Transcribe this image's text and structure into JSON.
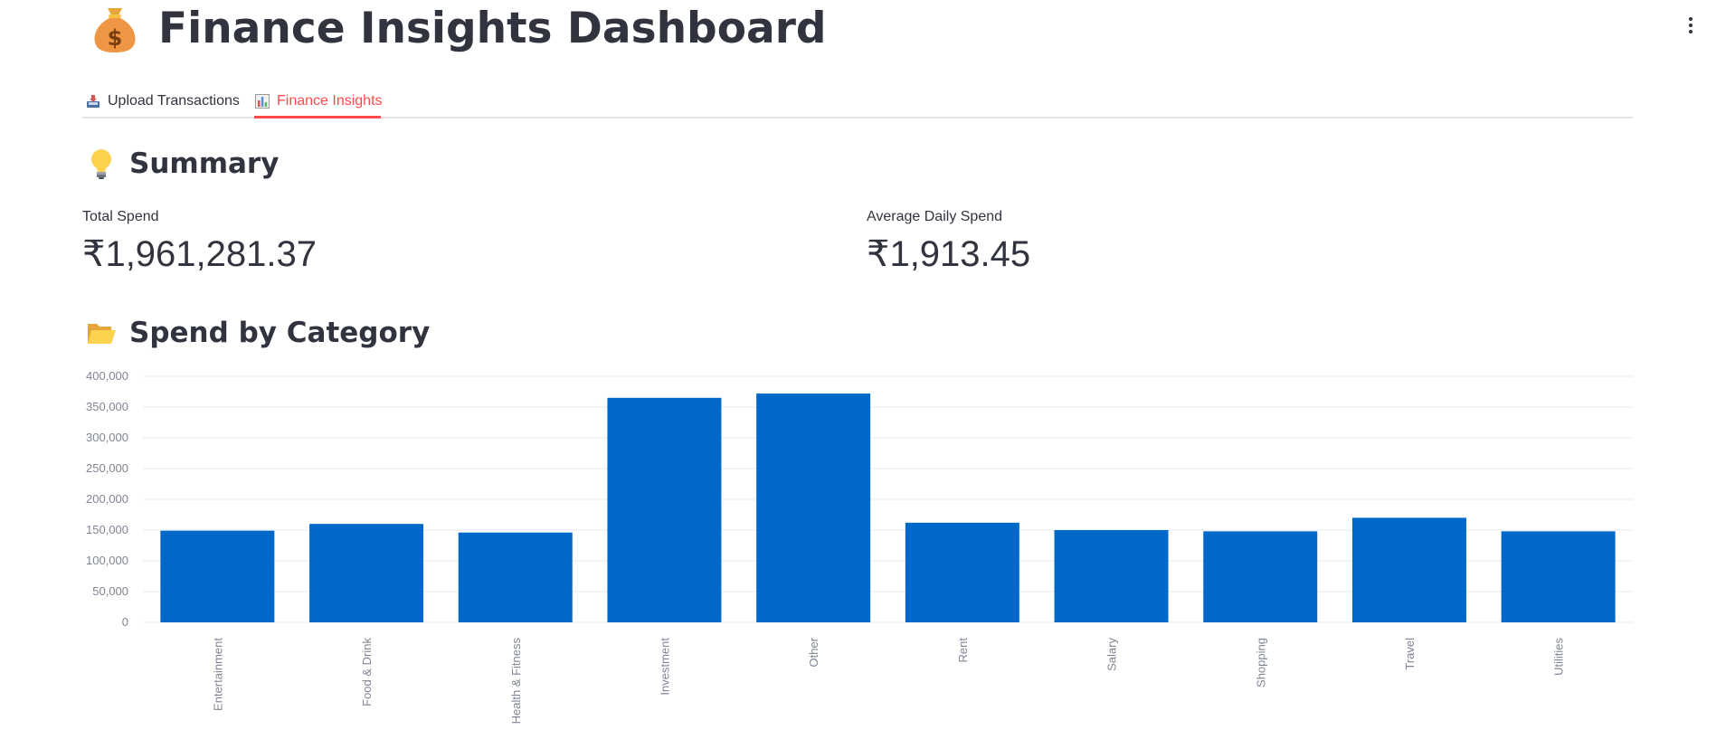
{
  "header": {
    "title": "Finance Insights Dashboard",
    "title_icon": "money-bag-icon",
    "menu_icon": "vertical-ellipsis-icon"
  },
  "tabs": [
    {
      "label": "Upload Transactions",
      "icon": "inbox-tray-icon",
      "active": false
    },
    {
      "label": "Finance Insights",
      "icon": "bar-chart-icon",
      "active": true
    }
  ],
  "summary": {
    "heading": "Summary",
    "icon": "light-bulb-icon",
    "total_spend_label": "Total Spend",
    "total_spend_value": "₹1,961,281.37",
    "avg_daily_label": "Average Daily Spend",
    "avg_daily_value": "₹1,913.45"
  },
  "spend_section": {
    "heading": "Spend by Category",
    "icon": "open-folder-icon"
  },
  "colors": {
    "accent": "#ff4b4b",
    "bar": "#0068c9",
    "text": "#31333f",
    "axis_text": "#808495",
    "grid": "#e6e9ef"
  },
  "chart_data": {
    "type": "bar",
    "categories": [
      "Entertainment",
      "Food & Drink",
      "Health & Fitness",
      "Investment",
      "Other",
      "Rent",
      "Salary",
      "Shopping",
      "Travel",
      "Utilities"
    ],
    "values": [
      149000,
      160000,
      146000,
      365000,
      372000,
      162000,
      150000,
      148000,
      170000,
      148000
    ],
    "yticks": [
      0,
      50000,
      100000,
      150000,
      200000,
      250000,
      300000,
      350000,
      400000
    ],
    "ytick_labels": [
      "0",
      "50,000",
      "100,000",
      "150,000",
      "200,000",
      "250,000",
      "300,000",
      "350,000",
      "400,000"
    ],
    "ylim": [
      0,
      400000
    ],
    "grid": true,
    "title": "",
    "xlabel": "",
    "ylabel": ""
  }
}
